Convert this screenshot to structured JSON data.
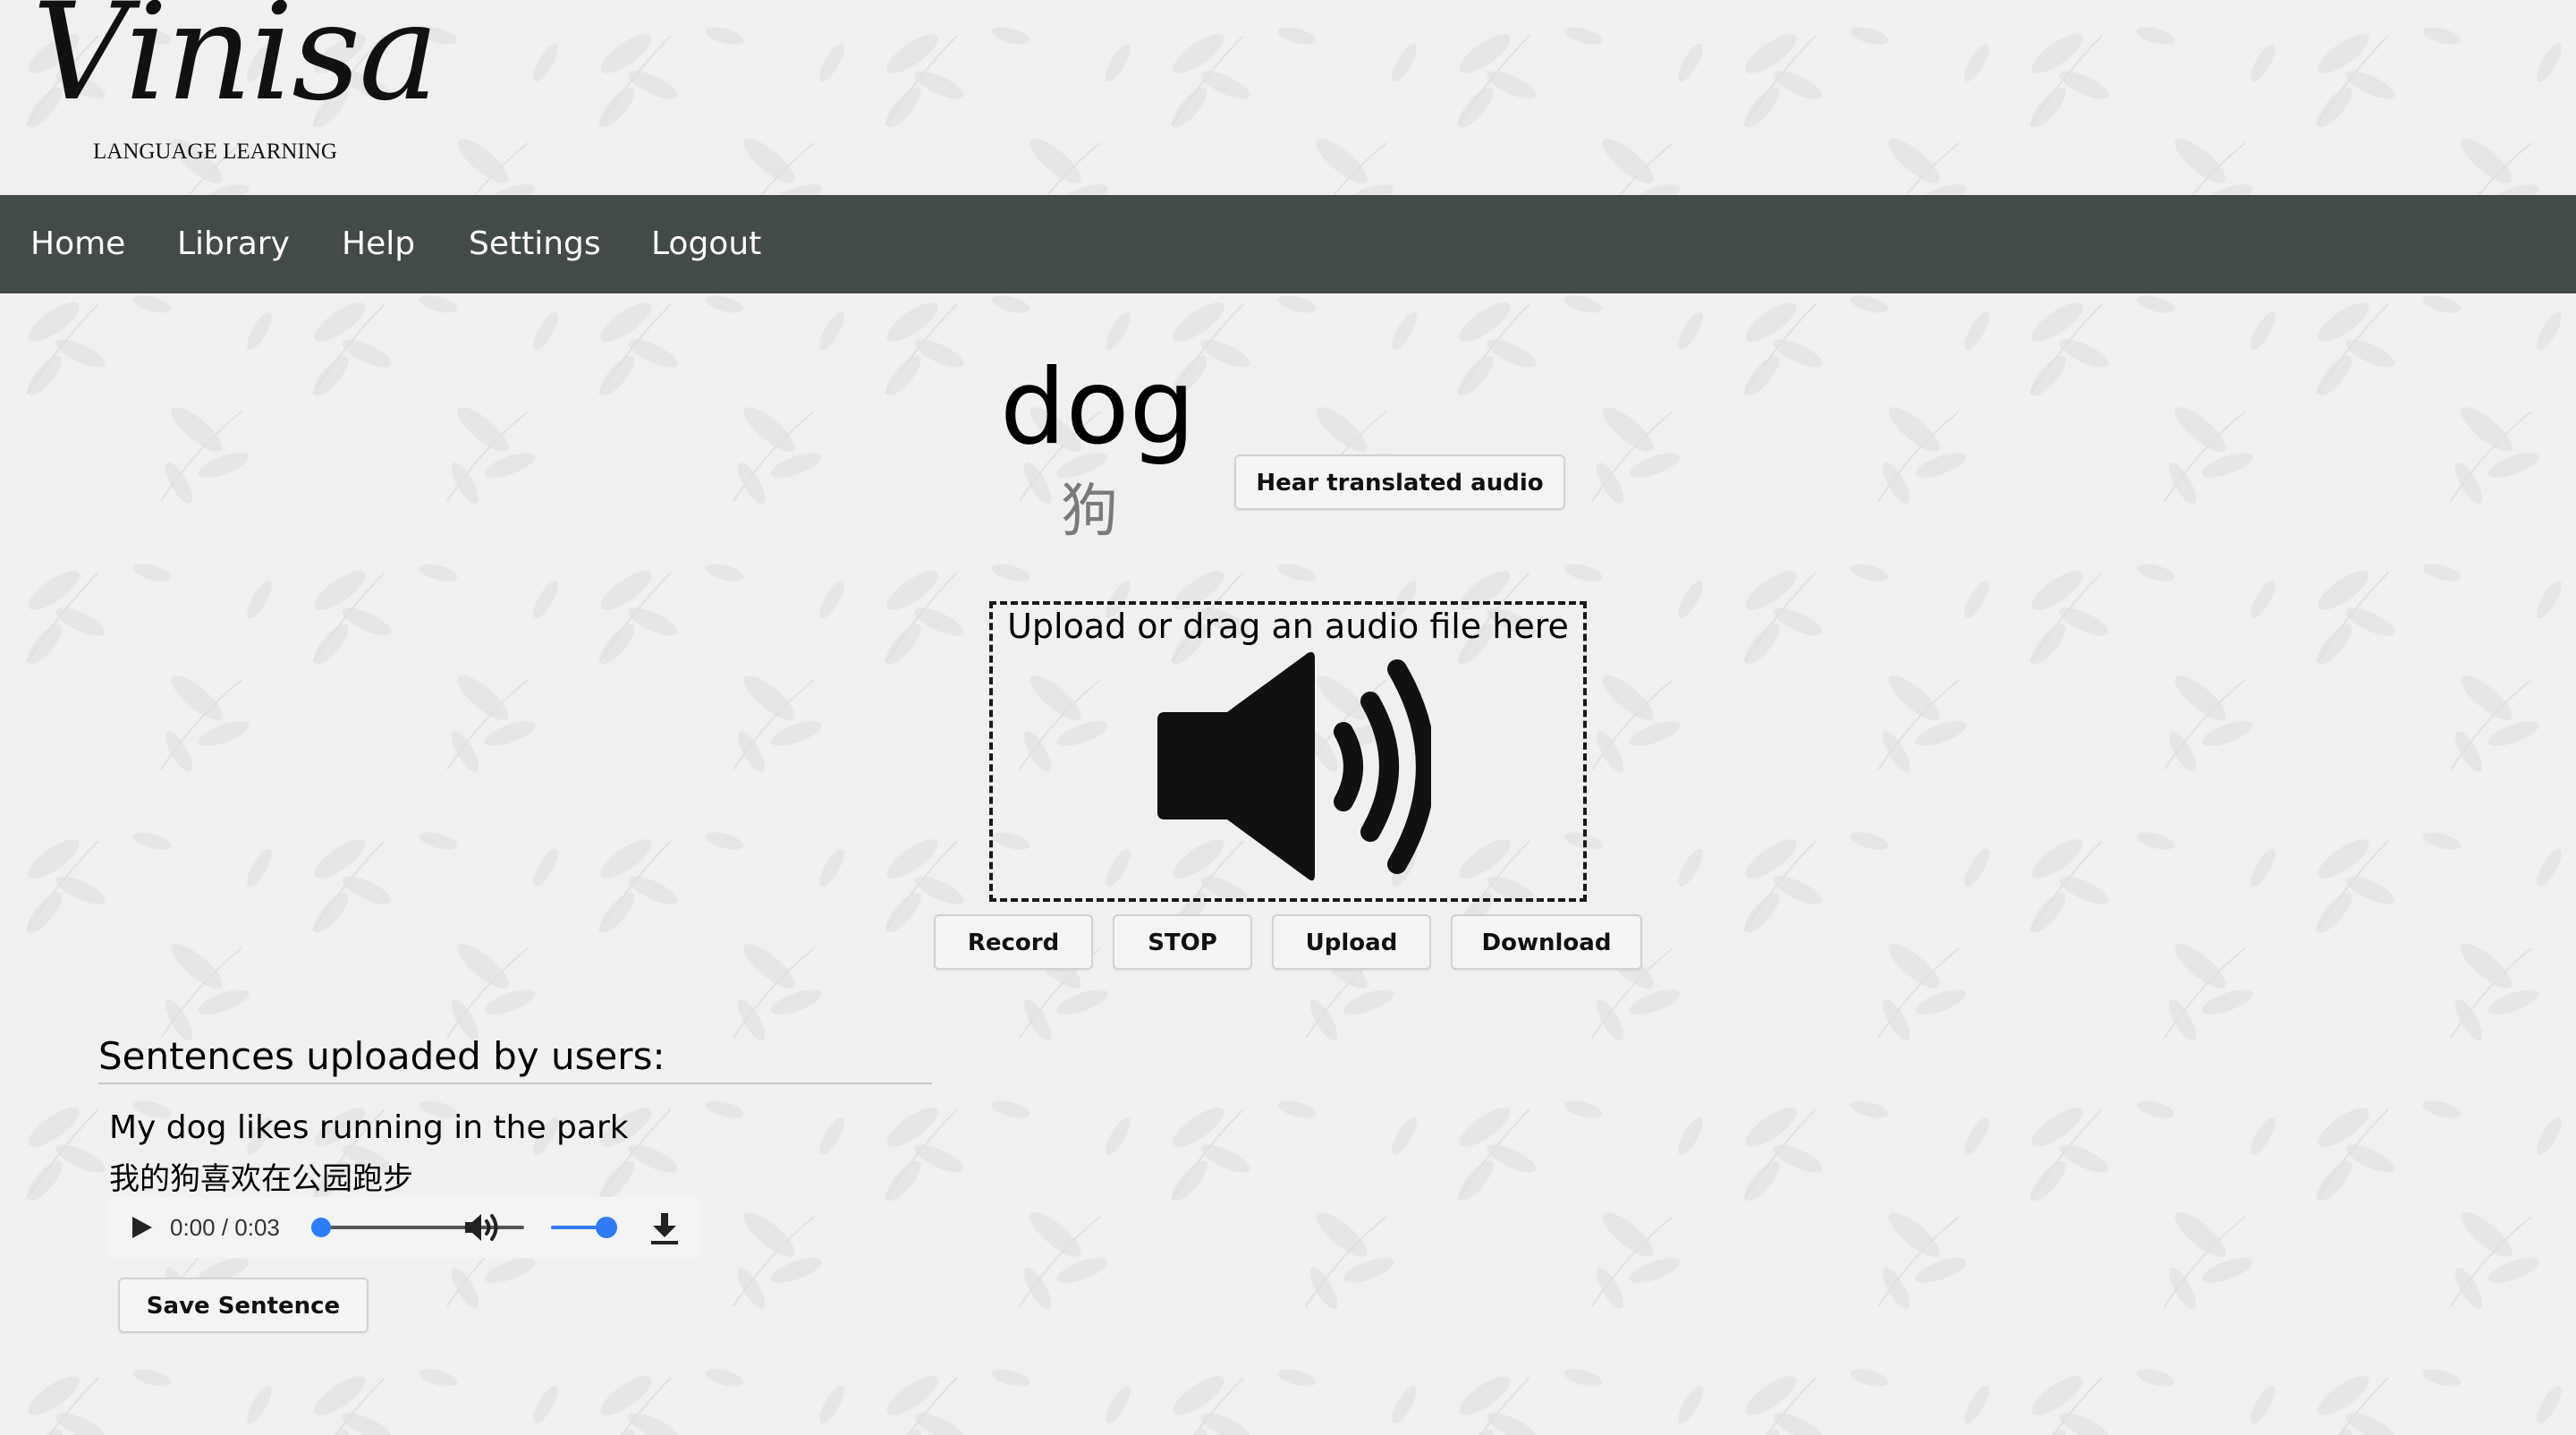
{
  "logo": {
    "word": "Vinisa",
    "subtitle": "LANGUAGE LEARNING"
  },
  "nav": {
    "items": [
      {
        "label": "Home"
      },
      {
        "label": "Library"
      },
      {
        "label": "Help"
      },
      {
        "label": "Settings"
      },
      {
        "label": "Logout"
      }
    ]
  },
  "word": {
    "term": "dog",
    "translation": "狗"
  },
  "hear_button": "Hear translated audio",
  "dropzone": {
    "label": "Upload or drag an audio file here",
    "icon": "speaker-icon"
  },
  "actions": {
    "record": "Record",
    "stop": "STOP",
    "upload": "Upload",
    "download": "Download"
  },
  "sentences_section": {
    "title": "Sentences uploaded by users:",
    "items": [
      {
        "english": "My dog likes running in the park",
        "chinese": "我的狗喜欢在公园跑步",
        "player": {
          "current_time": "0:00",
          "duration": "0:03",
          "time_display": "0:00 / 0:03",
          "progress_fraction": 0.0,
          "volume_fraction": 1.0
        },
        "save_label": "Save Sentence"
      }
    ]
  },
  "colors": {
    "navbar_bg": "#434a4a",
    "nav_text": "#ffffff",
    "page_bg": "#f1f0f1",
    "accent_blue": "#2f7cf6"
  }
}
